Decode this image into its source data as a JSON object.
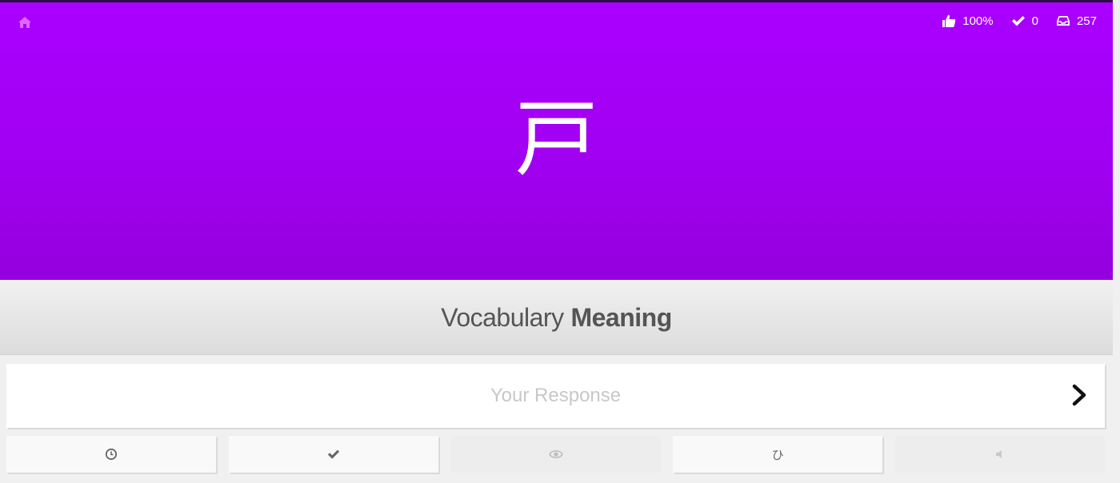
{
  "header": {
    "home_icon": "home-icon",
    "stats": {
      "percent_correct": "100%",
      "completed": "0",
      "remaining": "257"
    }
  },
  "character": {
    "text": "戸"
  },
  "question": {
    "category": "Vocabulary",
    "type": "Meaning"
  },
  "answer": {
    "placeholder": "Your Response",
    "value": ""
  },
  "buttons": {
    "last_items": "clock-icon",
    "mark": "check-icon",
    "item_info": "eye-icon",
    "kana_chart": "ひ",
    "audio": "speaker-icon"
  },
  "colors": {
    "vocabulary": "#aa00ff",
    "vocabulary_dark": "#9400dd"
  }
}
